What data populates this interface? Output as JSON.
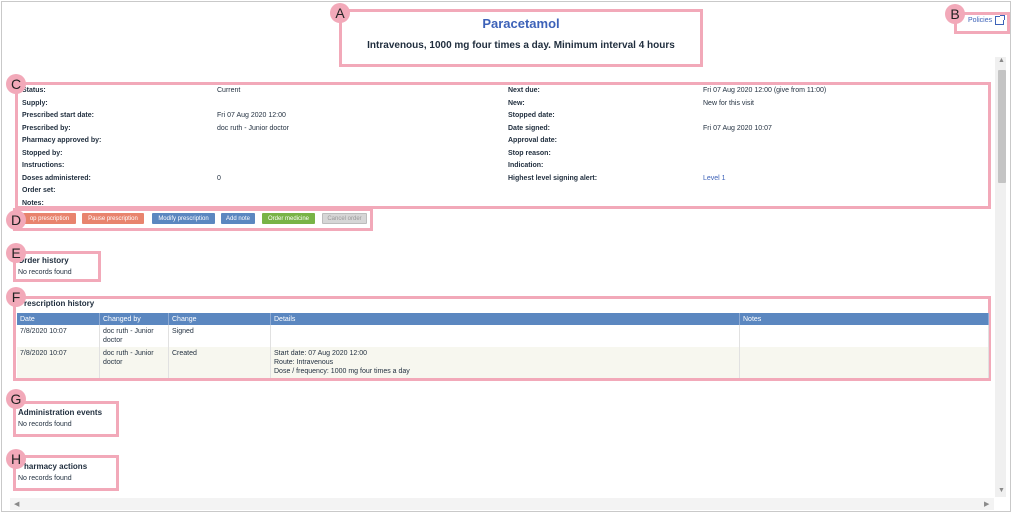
{
  "header": {
    "drug_name": "Paracetamol",
    "dose_summary": "Intravenous, 1000 mg four times a day. Minimum interval 4 hours",
    "policies_label": "Policies"
  },
  "markers": [
    "A",
    "B",
    "C",
    "D",
    "E",
    "F",
    "G",
    "H"
  ],
  "details": {
    "left": [
      {
        "label": "Status:",
        "value": "Current"
      },
      {
        "label": "Supply:",
        "value": ""
      },
      {
        "label": "Prescribed start date:",
        "value": "Fri 07 Aug 2020 12:00"
      },
      {
        "label": "Prescribed by:",
        "value": "doc ruth - Junior doctor"
      },
      {
        "label": "Pharmacy approved by:",
        "value": ""
      },
      {
        "label": "Stopped by:",
        "value": ""
      },
      {
        "label": "Instructions:",
        "value": ""
      },
      {
        "label": "Doses administered:",
        "value": "0"
      },
      {
        "label": "Order set:",
        "value": ""
      },
      {
        "label": "Notes:",
        "value": ""
      }
    ],
    "right": [
      {
        "label": "Next due:",
        "value": "Fri 07 Aug 2020 12:00 (give from 11:00)"
      },
      {
        "label": "New:",
        "value": "New for this visit"
      },
      {
        "label": "Stopped date:",
        "value": ""
      },
      {
        "label": "Date signed:",
        "value": "Fri 07 Aug 2020 10:07"
      },
      {
        "label": "Approval date:",
        "value": ""
      },
      {
        "label": "Stop reason:",
        "value": ""
      },
      {
        "label": "Indication:",
        "value": ""
      },
      {
        "label": "Highest level signing alert:",
        "value": "Level 1"
      }
    ]
  },
  "actions": {
    "stop": "op prescription",
    "pause": "Pause prescription",
    "modify": "Modify prescription",
    "add_note": "Add note",
    "order_medicine": "Order medicine",
    "cancel_order": "Cancel order"
  },
  "colors": {
    "stop": "#e8836d",
    "pause": "#e8836d",
    "modify": "#5b87c0",
    "add_note": "#5b87c0",
    "order_medicine": "#78b346",
    "cancel_order": "#d6d6d6",
    "marker": "#f2a9b9",
    "accent": "#3d62b8"
  },
  "order_history": {
    "title": "Order history",
    "empty": "No records found"
  },
  "prescription_history": {
    "title": "rescription history",
    "columns": [
      "Date",
      "Changed by",
      "Change",
      "Details",
      "Notes"
    ],
    "rows": [
      {
        "date": "7/8/2020 10:07",
        "changed_by": "doc ruth - Junior doctor",
        "change": "Signed",
        "details": [
          "",
          "",
          ""
        ],
        "notes": ""
      },
      {
        "date": "7/8/2020 10:07",
        "changed_by": "doc ruth - Junior doctor",
        "change": "Created",
        "details": [
          "Start date: 07 Aug 2020 12:00",
          "Route: Intravenous",
          "Dose / frequency: 1000 mg four times a day"
        ],
        "notes": ""
      }
    ]
  },
  "administration_events": {
    "title": "Administration events",
    "empty": "No records found"
  },
  "pharmacy_actions": {
    "title": "harmacy actions",
    "empty": "No records found"
  }
}
